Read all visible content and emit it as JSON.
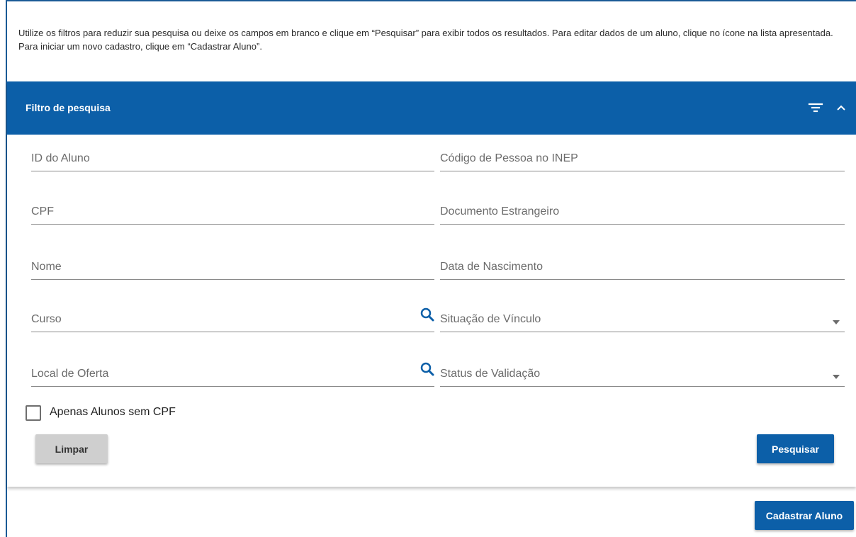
{
  "intro": {
    "text": "Utilize os filtros para reduzir sua pesquisa ou deixe os campos em branco e clique em “Pesquisar” para exibir todos os resultados. Para editar dados de um aluno, clique no ícone na lista apresentada. Para iniciar um novo cadastro, clique em “Cadastrar Aluno”."
  },
  "panel": {
    "title": "Filtro de pesquisa",
    "header_color": "#0c5fa8",
    "icons": [
      "filter-icon",
      "chevron-up-icon"
    ]
  },
  "fields": {
    "id_aluno": {
      "label": "ID do Aluno"
    },
    "codigo_inep": {
      "label": "Código de Pessoa no INEP"
    },
    "cpf": {
      "label": "CPF"
    },
    "documento_estrangeiro": {
      "label": "Documento Estrangeiro"
    },
    "nome": {
      "label": "Nome"
    },
    "data_nascimento": {
      "label": "Data de Nascimento"
    },
    "curso": {
      "label": "Curso",
      "icon": "search-icon"
    },
    "situacao_vinculo": {
      "label": "Situação de Vínculo",
      "icon": "dropdown-arrow-icon"
    },
    "local_oferta": {
      "label": "Local de Oferta",
      "icon": "search-icon"
    },
    "status_validacao": {
      "label": "Status de Validação",
      "icon": "dropdown-arrow-icon"
    }
  },
  "checkbox": {
    "label": "Apenas Alunos sem CPF",
    "checked": false
  },
  "buttons": {
    "limpar": "Limpar",
    "pesquisar": "Pesquisar",
    "cadastrar": "Cadastrar Aluno"
  },
  "colors": {
    "primary": "#0c5fa8",
    "secondary_button": "#cfcfcf",
    "search_icon": "#0c5fa8"
  }
}
